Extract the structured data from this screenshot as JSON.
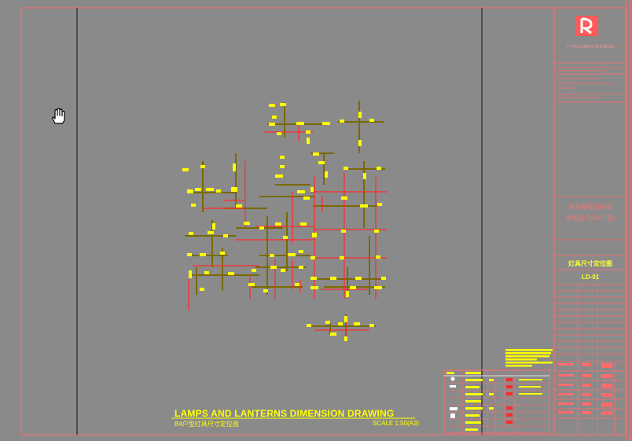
{
  "drawing": {
    "title_en": "LAMPS AND LANTERNS DIMENSION DRAWING",
    "title_cn": "B4户型灯具尺寸定位图",
    "scale": "SCALE 1:50(A3)"
  },
  "title_block": {
    "company": "广州市XX装饰工程有限公司",
    "project_name": "青岛春晖园项目",
    "project_sub": "住宅部分(B4户型)",
    "drawing_name": "灯具尺寸定位图",
    "drawing_number": "LD-01"
  },
  "colors": {
    "background": "#8a8a8a",
    "frame": "#ff6b6b",
    "dimension": "#ffff00",
    "lamp_line": "#ff2a2a",
    "wall_line": "#7a6a00"
  },
  "cursor": {
    "icon": "hand-pan-icon"
  }
}
